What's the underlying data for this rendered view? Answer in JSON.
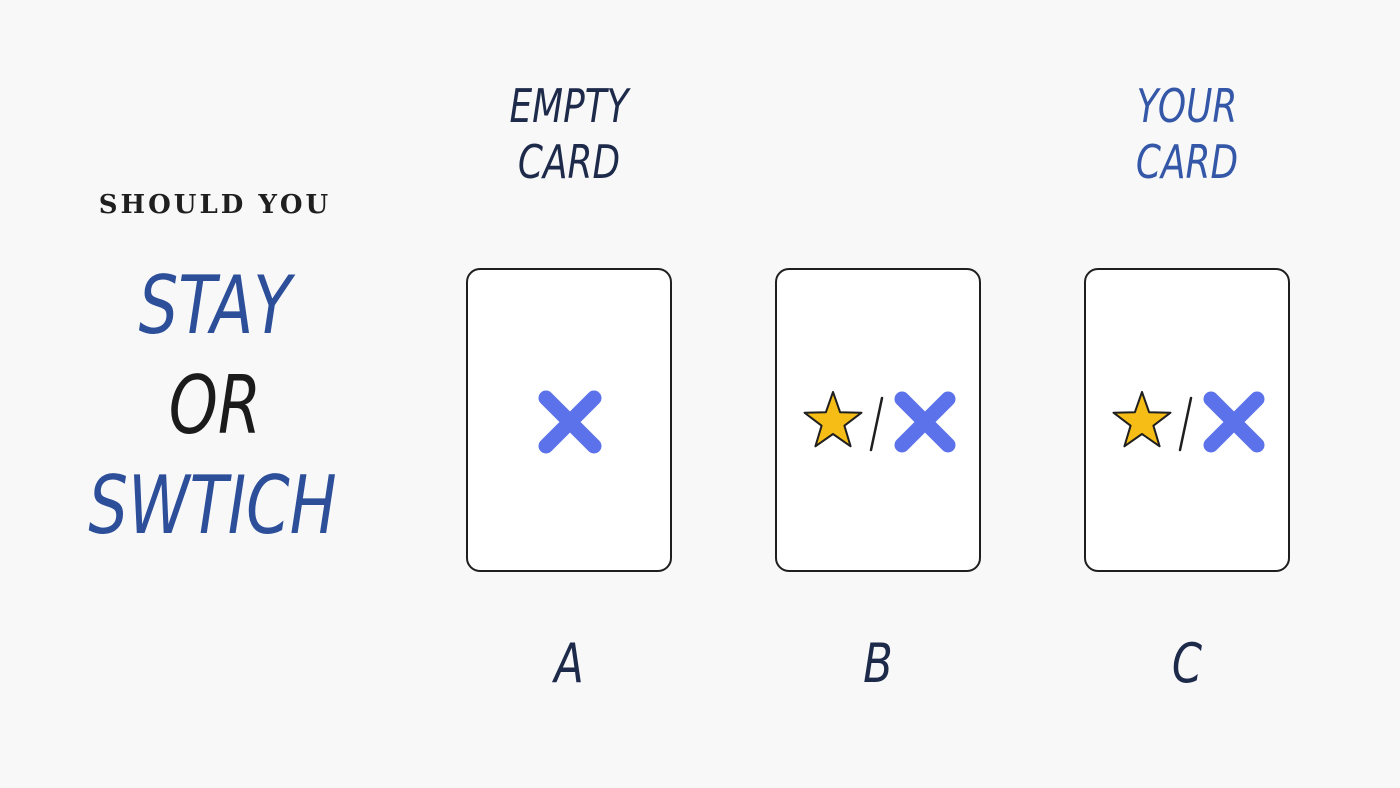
{
  "prompt": {
    "intro": "SHOULD YOU",
    "option_1": "STAY",
    "connector": "OR",
    "option_2": "SWTICH"
  },
  "cards": [
    {
      "top_label": "EMPTY CARD",
      "letter": "A",
      "content": [
        "x-icon"
      ]
    },
    {
      "top_label": "",
      "letter": "B",
      "content": [
        "star-icon",
        "slash",
        "x-icon"
      ]
    },
    {
      "top_label": "YOUR CARD",
      "letter": "C",
      "content": [
        "star-icon",
        "slash",
        "x-icon"
      ]
    }
  ],
  "colors": {
    "background": "#f8f8f9",
    "accent_blue": "#2d4f9a",
    "x_mark": "#5b72ea",
    "star": "#f6bd16",
    "your_card_label": "#3457a8"
  }
}
